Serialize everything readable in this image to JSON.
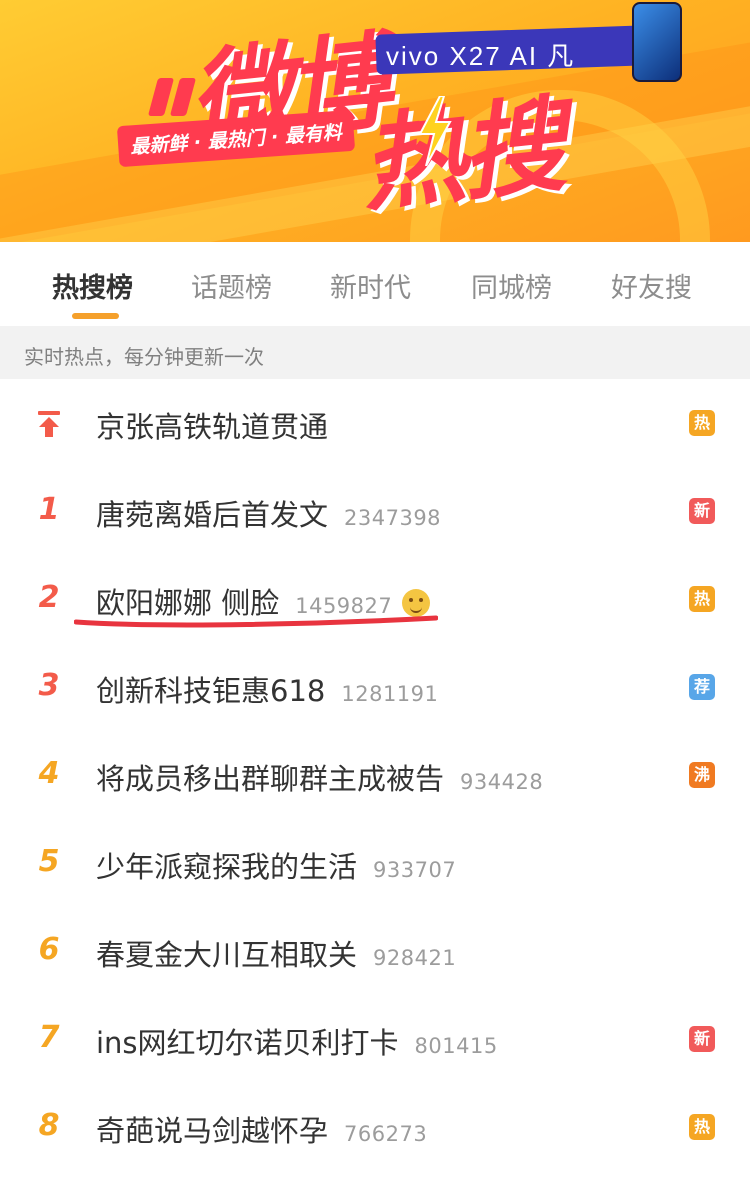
{
  "banner": {
    "brand_a": "微博",
    "brand_b": "热搜",
    "slogan": "最新鲜 · 最热门 · 最有料",
    "ad_text": "vivo X27 AI 凡"
  },
  "tabs": [
    {
      "label": "热搜榜",
      "active": true
    },
    {
      "label": "话题榜",
      "active": false
    },
    {
      "label": "新时代",
      "active": false
    },
    {
      "label": "同城榜",
      "active": false
    },
    {
      "label": "好友搜",
      "active": false
    }
  ],
  "subheader": "实时热点，每分钟更新一次",
  "colors": {
    "accent": "#f5a02b",
    "rank_top": "#f35b4a",
    "rank_low": "#f5a623",
    "badge_hot": "#f5a623",
    "badge_new": "#f15a5a",
    "badge_recommend": "#58a6e8",
    "badge_boil": "#f07a21",
    "highlight_underline": "#e8343f"
  },
  "list": [
    {
      "rank": "",
      "pinned": true,
      "title": "京张高铁轨道贯通",
      "count": "",
      "badge": "热",
      "badge_type": "hot"
    },
    {
      "rank": "1",
      "title": "唐菀离婚后首发文",
      "count": "2347398",
      "badge": "新",
      "badge_type": "new"
    },
    {
      "rank": "2",
      "title": "欧阳娜娜 侧脸",
      "count": "1459827",
      "emoji": "smile-emoji",
      "badge": "热",
      "badge_type": "hot"
    },
    {
      "rank": "3",
      "title": "创新科技钜惠618",
      "count": "1281191",
      "badge": "荐",
      "badge_type": "recommend"
    },
    {
      "rank": "4",
      "title": "将成员移出群聊群主成被告",
      "count": "934428",
      "badge": "沸",
      "badge_type": "boil"
    },
    {
      "rank": "5",
      "title": "少年派窥探我的生活",
      "count": "933707",
      "badge": "",
      "badge_type": ""
    },
    {
      "rank": "6",
      "title": "春夏金大川互相取关",
      "count": "928421",
      "badge": "",
      "badge_type": ""
    },
    {
      "rank": "7",
      "title": "ins网红切尔诺贝利打卡",
      "count": "801415",
      "badge": "新",
      "badge_type": "new"
    },
    {
      "rank": "8",
      "title": "奇葩说马剑越怀孕",
      "count": "766273",
      "badge": "热",
      "badge_type": "hot"
    }
  ]
}
